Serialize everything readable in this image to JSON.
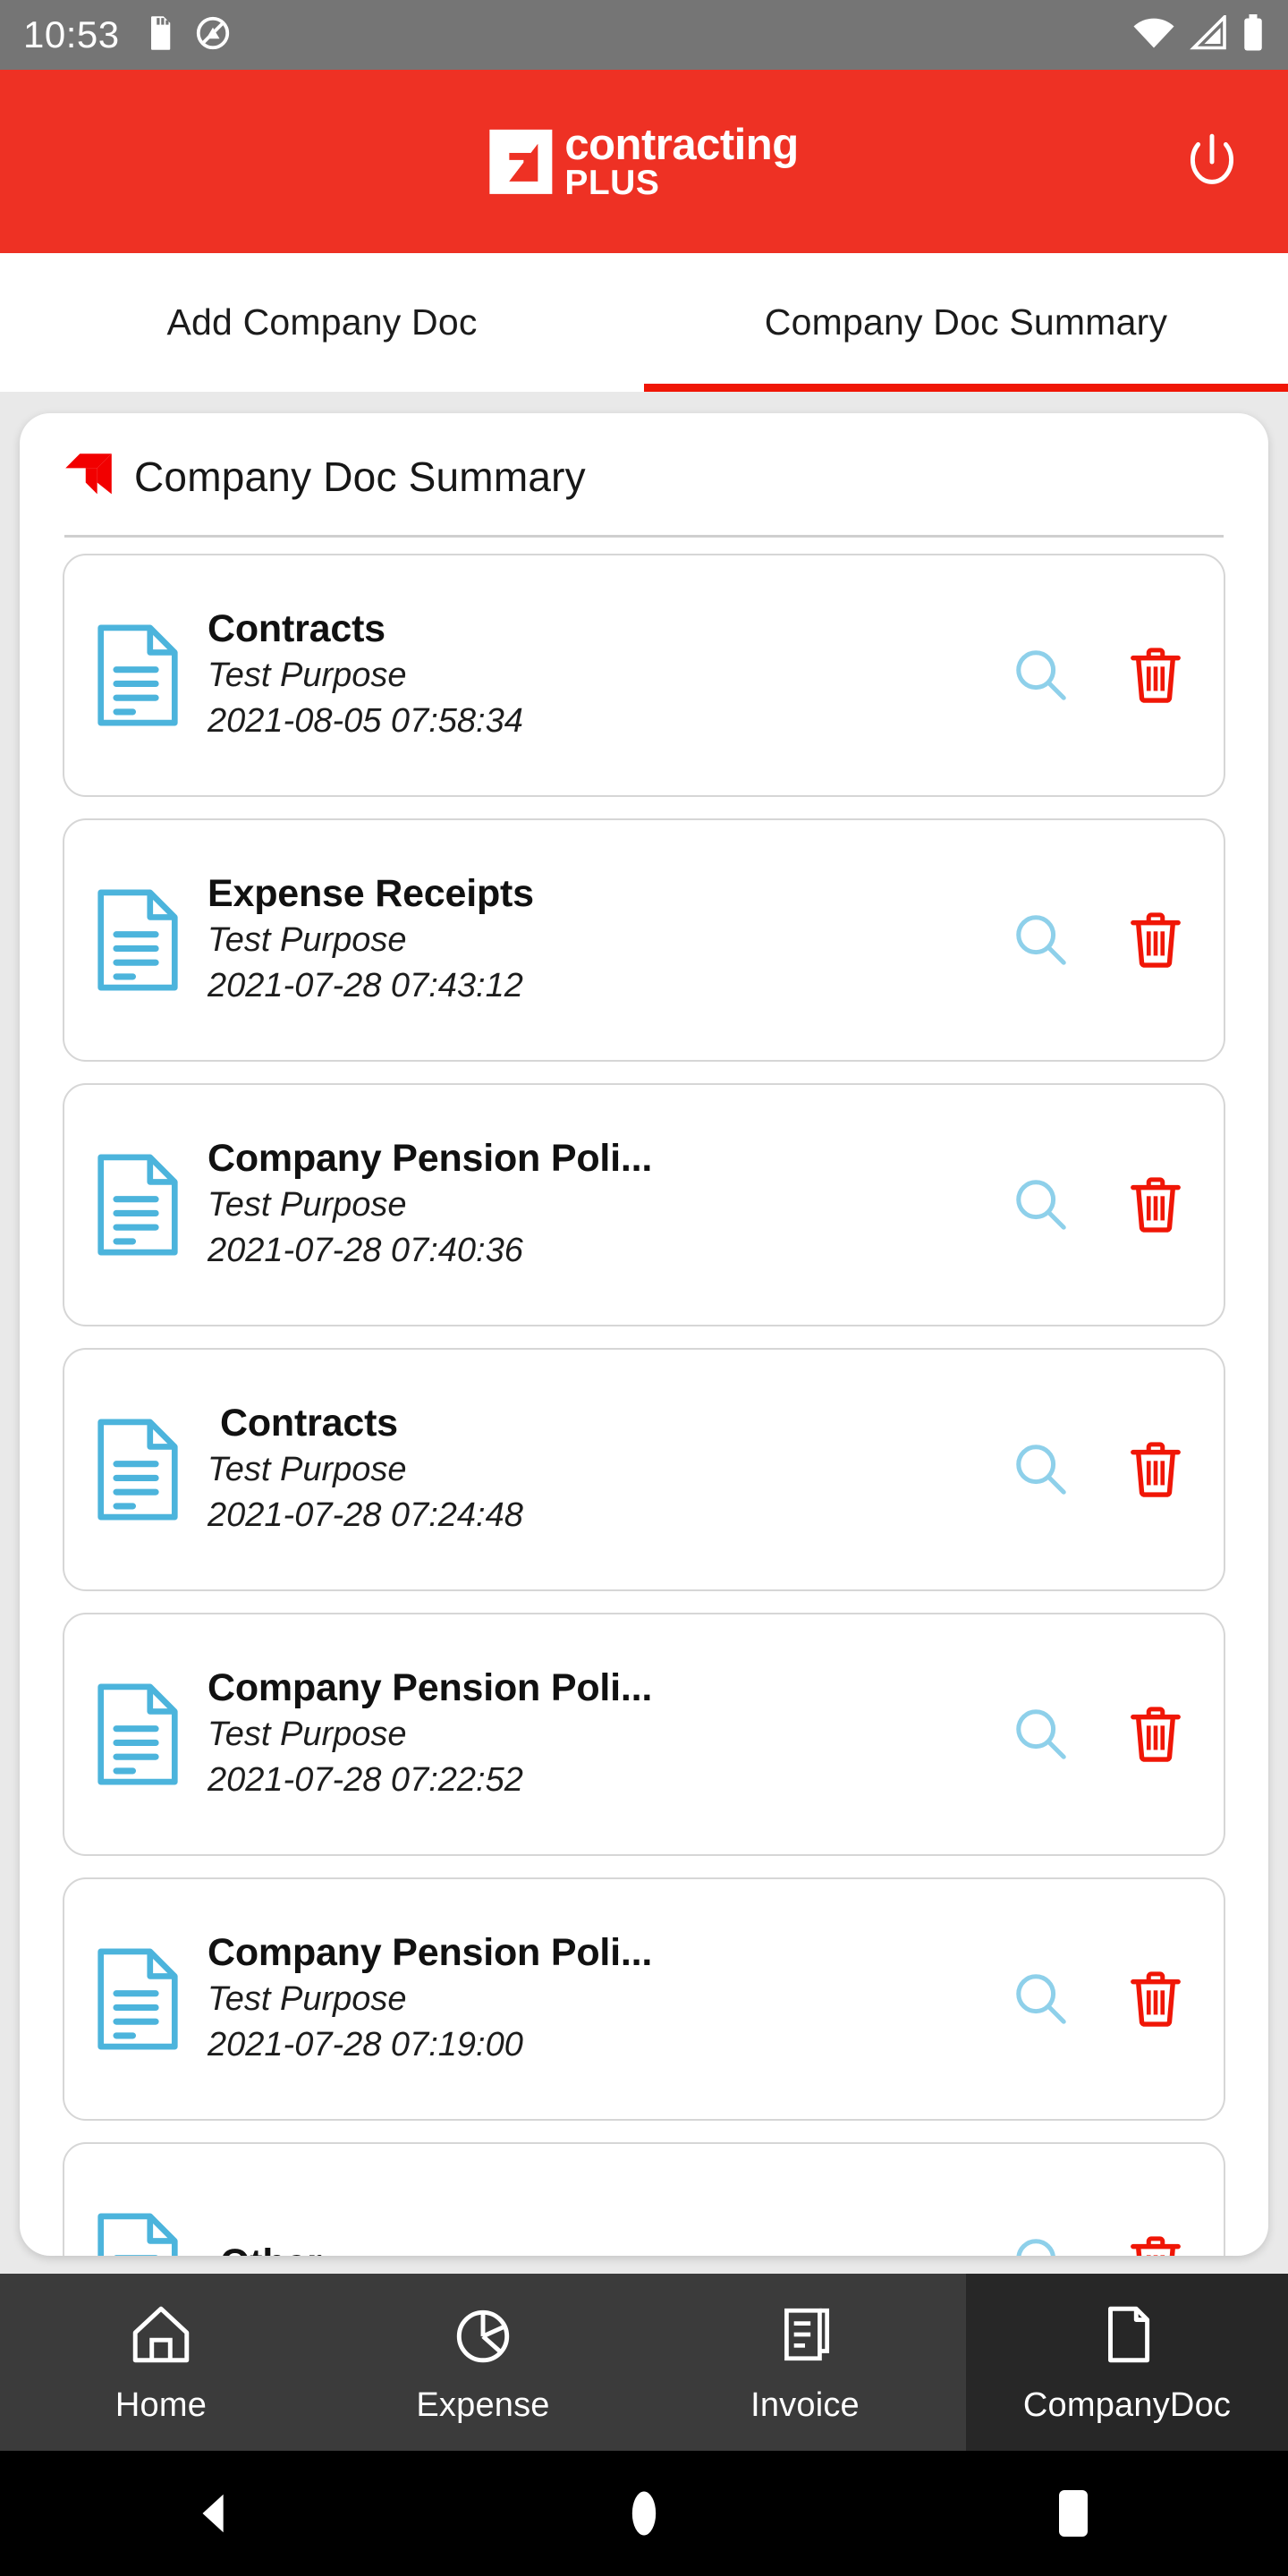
{
  "status_bar": {
    "time": "10:53",
    "left_icons": [
      "sd-card-icon",
      "screen-capture-icon"
    ],
    "right_icons": [
      "wifi-icon",
      "cellular-signal-icon",
      "battery-icon"
    ],
    "background": "#757575"
  },
  "header": {
    "brand_line1": "contracting",
    "brand_line2": "PLUS",
    "logo_icon": "contracting-plus-logo",
    "power_icon": "power-icon",
    "background": "#ee3124"
  },
  "tabs": {
    "items": [
      {
        "label": "Add Company Doc",
        "active": false
      },
      {
        "label": "Company Doc Summary",
        "active": true
      }
    ],
    "indicator_color": "#f01606"
  },
  "card": {
    "title": "Company Doc Summary",
    "logo_icon": "contracting-plus-mark",
    "accent_color": "#f20000"
  },
  "documents": {
    "purpose_label": "Test Purpose",
    "view_icon": "search-icon",
    "delete_icon": "trash-icon",
    "doc_icon": "document-icon",
    "icon_color": "#4cb4dc",
    "delete_color": "#f01606",
    "rows": [
      {
        "title": "Contracts",
        "purpose": "Test Purpose",
        "date": "2021-08-05 07:58:34"
      },
      {
        "title": "Expense Receipts",
        "purpose": "Test Purpose",
        "date": "2021-07-28 07:43:12"
      },
      {
        "title": "Company Pension Poli...",
        "purpose": "Test Purpose",
        "date": "2021-07-28 07:40:36"
      },
      {
        "title": "Contracts",
        "purpose": "Test Purpose",
        "date": "2021-07-28 07:24:48"
      },
      {
        "title": "Company Pension Poli...",
        "purpose": "Test Purpose",
        "date": "2021-07-28 07:22:52"
      },
      {
        "title": "Company Pension Poli...",
        "purpose": "Test Purpose",
        "date": "2021-07-28 07:19:00"
      },
      {
        "title": "Other",
        "purpose": "",
        "date": ""
      }
    ]
  },
  "bottom_nav": {
    "items": [
      {
        "label": "Home",
        "icon": "home-icon",
        "active": false
      },
      {
        "label": "Expense",
        "icon": "pie-chart-icon",
        "active": false
      },
      {
        "label": "Invoice",
        "icon": "receipt-icon",
        "active": false
      },
      {
        "label": "CompanyDoc",
        "icon": "document-icon",
        "active": true
      }
    ]
  },
  "android_nav": {
    "back": "back-icon",
    "home": "home-pill-icon",
    "recents": "recents-icon"
  }
}
